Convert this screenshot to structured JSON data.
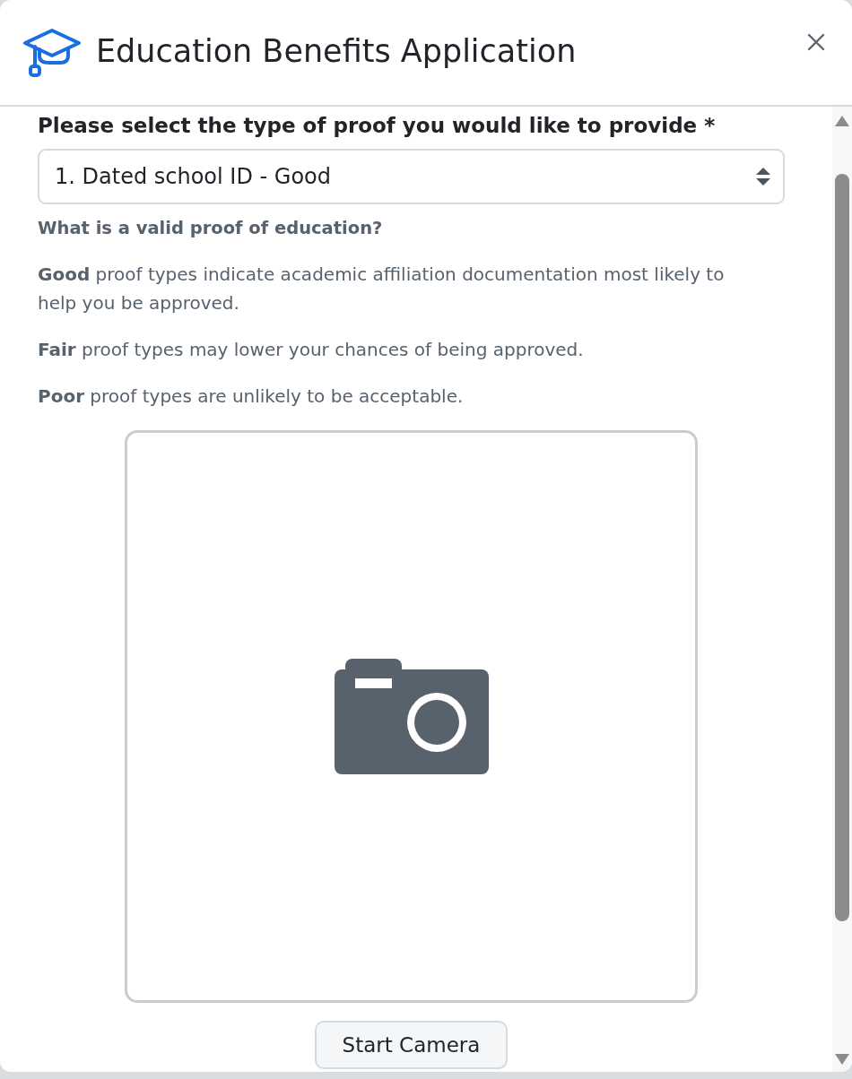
{
  "dialog": {
    "title": "Education Benefits Application"
  },
  "form": {
    "label": "Please select the type of proof you would like to provide *",
    "select": {
      "value": "1. Dated school ID - Good"
    },
    "help": {
      "heading": "What is a valid proof of education?",
      "paragraphs": [
        "**Good** proof types indicate academic affiliation documentation most likely to help you be approved.",
        "**Fair** proof types may lower your chances of being approved.",
        "**Poor** proof types are unlikely to be acceptable."
      ]
    }
  },
  "camera": {
    "button": "Start Camera"
  }
}
